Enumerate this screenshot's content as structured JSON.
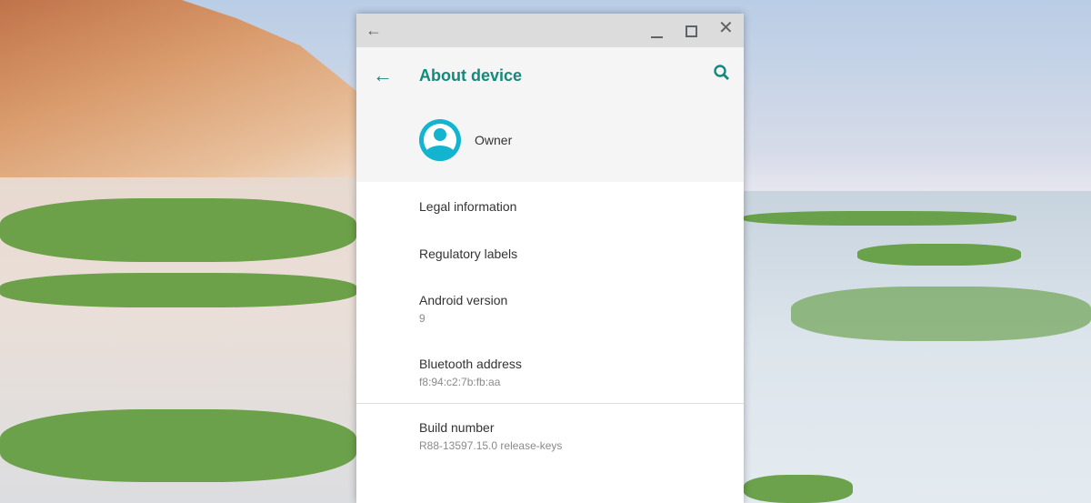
{
  "window": {
    "controls": {
      "back": "back-arrow",
      "minimize": "minimize",
      "maximize": "maximize",
      "close": "close"
    }
  },
  "header": {
    "title": "About device"
  },
  "account": {
    "name": "Owner"
  },
  "items": [
    {
      "label": "Legal information"
    },
    {
      "label": "Regulatory labels"
    },
    {
      "label": "Android version",
      "value": "9"
    },
    {
      "label": "Bluetooth address",
      "value": "f8:94:c2:7b:fb:aa"
    },
    {
      "label": "Build number",
      "value": "R88-13597.15.0 release-keys"
    }
  ],
  "colors": {
    "accent": "#138a7b",
    "avatar": "#12b4cf"
  }
}
